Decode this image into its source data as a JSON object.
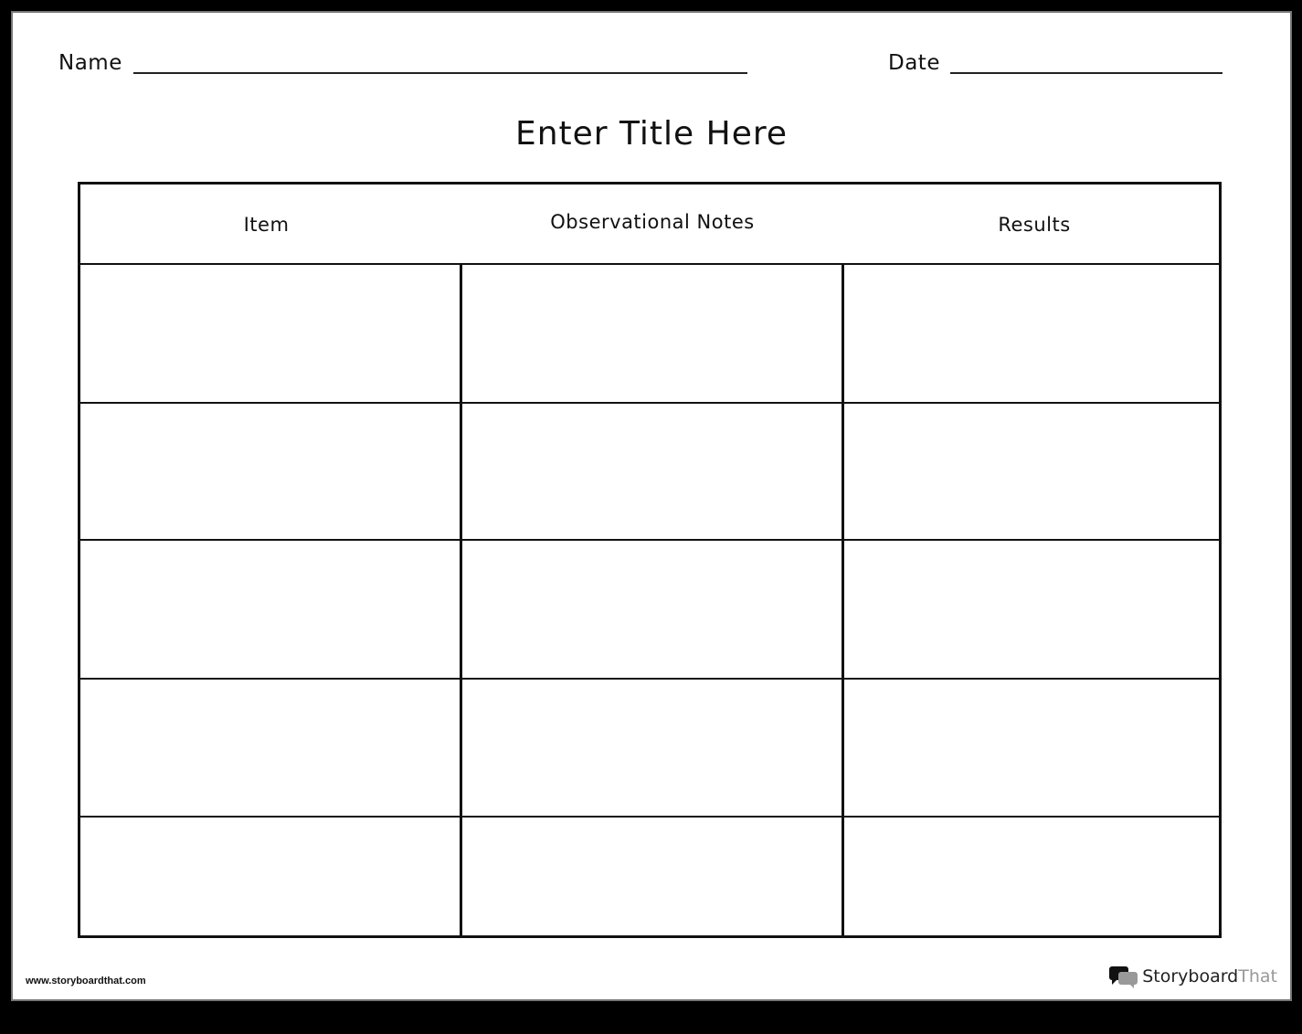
{
  "worksheet": {
    "name_label": "Name",
    "date_label": "Date",
    "title": "Enter Title Here",
    "table": {
      "headers": [
        "Item",
        "Observational Notes",
        "Results"
      ],
      "rows": [
        [
          "",
          "",
          ""
        ],
        [
          "",
          "",
          ""
        ],
        [
          "",
          "",
          ""
        ],
        [
          "",
          "",
          ""
        ],
        [
          "",
          "",
          ""
        ]
      ]
    }
  },
  "footer": {
    "url": "www.storyboardthat.com",
    "brand_part1": "Storyboard",
    "brand_part2": "That",
    "logo_icon": "speech-bubbles-icon"
  },
  "colors": {
    "background": "#000000",
    "page": "#ffffff",
    "ink": "#111111",
    "brand_gray": "#999999"
  }
}
